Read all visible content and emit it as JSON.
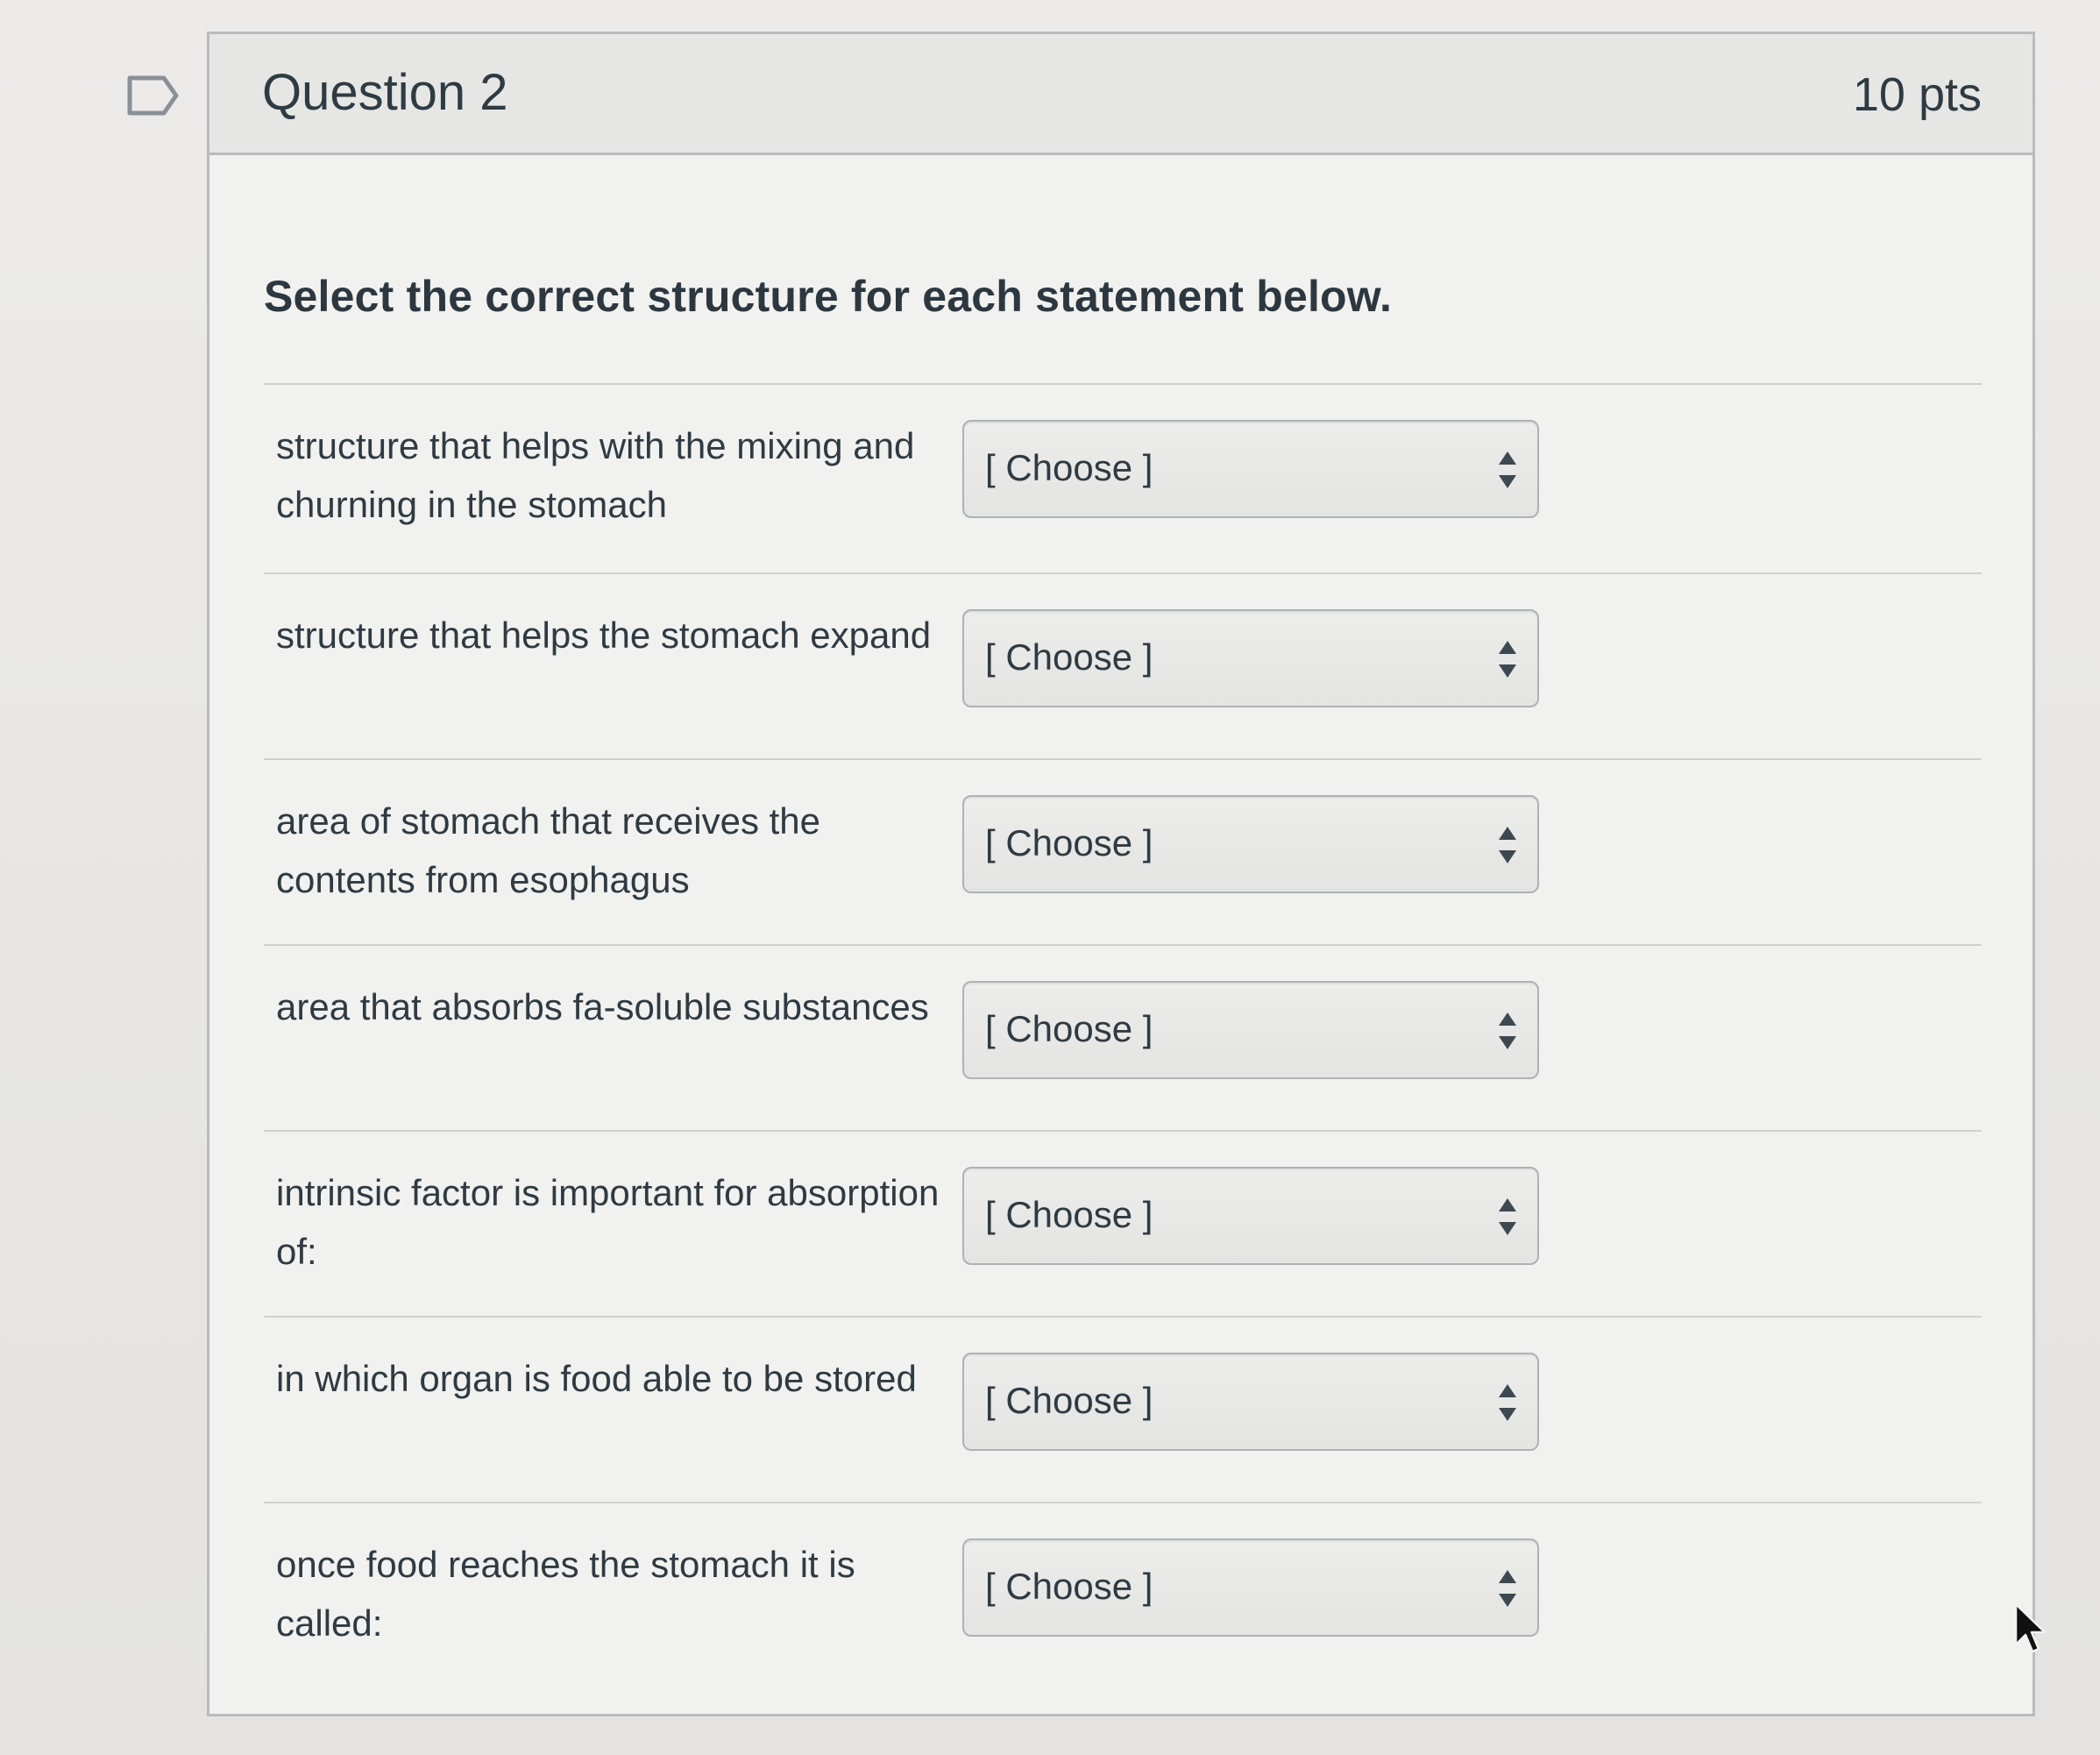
{
  "question": {
    "title": "Question 2",
    "points": "10 pts",
    "prompt": "Select the correct structure for each statement below."
  },
  "rows": [
    {
      "statement": "structure that helps with the mixing and churning in the stomach",
      "select_value": "[ Choose ]"
    },
    {
      "statement": "structure that helps the stomach expand",
      "select_value": "[ Choose ]"
    },
    {
      "statement": "area of stomach that receives the contents from esophagus",
      "select_value": "[ Choose ]"
    },
    {
      "statement": "area that absorbs fa-soluble substances",
      "select_value": "[ Choose ]"
    },
    {
      "statement": "intrinsic factor is important for absorption of:",
      "select_value": "[ Choose ]"
    },
    {
      "statement": "in which organ is food able to be stored",
      "select_value": "[ Choose ]"
    },
    {
      "statement": "once food reaches the stomach it is called:",
      "select_value": "[ Choose ]"
    }
  ],
  "icons": {
    "flag": "flag-icon",
    "select_arrows": "sort-arrows-icon",
    "cursor": "cursor-icon"
  },
  "colors": {
    "page_background": "#e9e9e7",
    "card_border": "#b9bcbe",
    "text": "#2f3a42"
  }
}
